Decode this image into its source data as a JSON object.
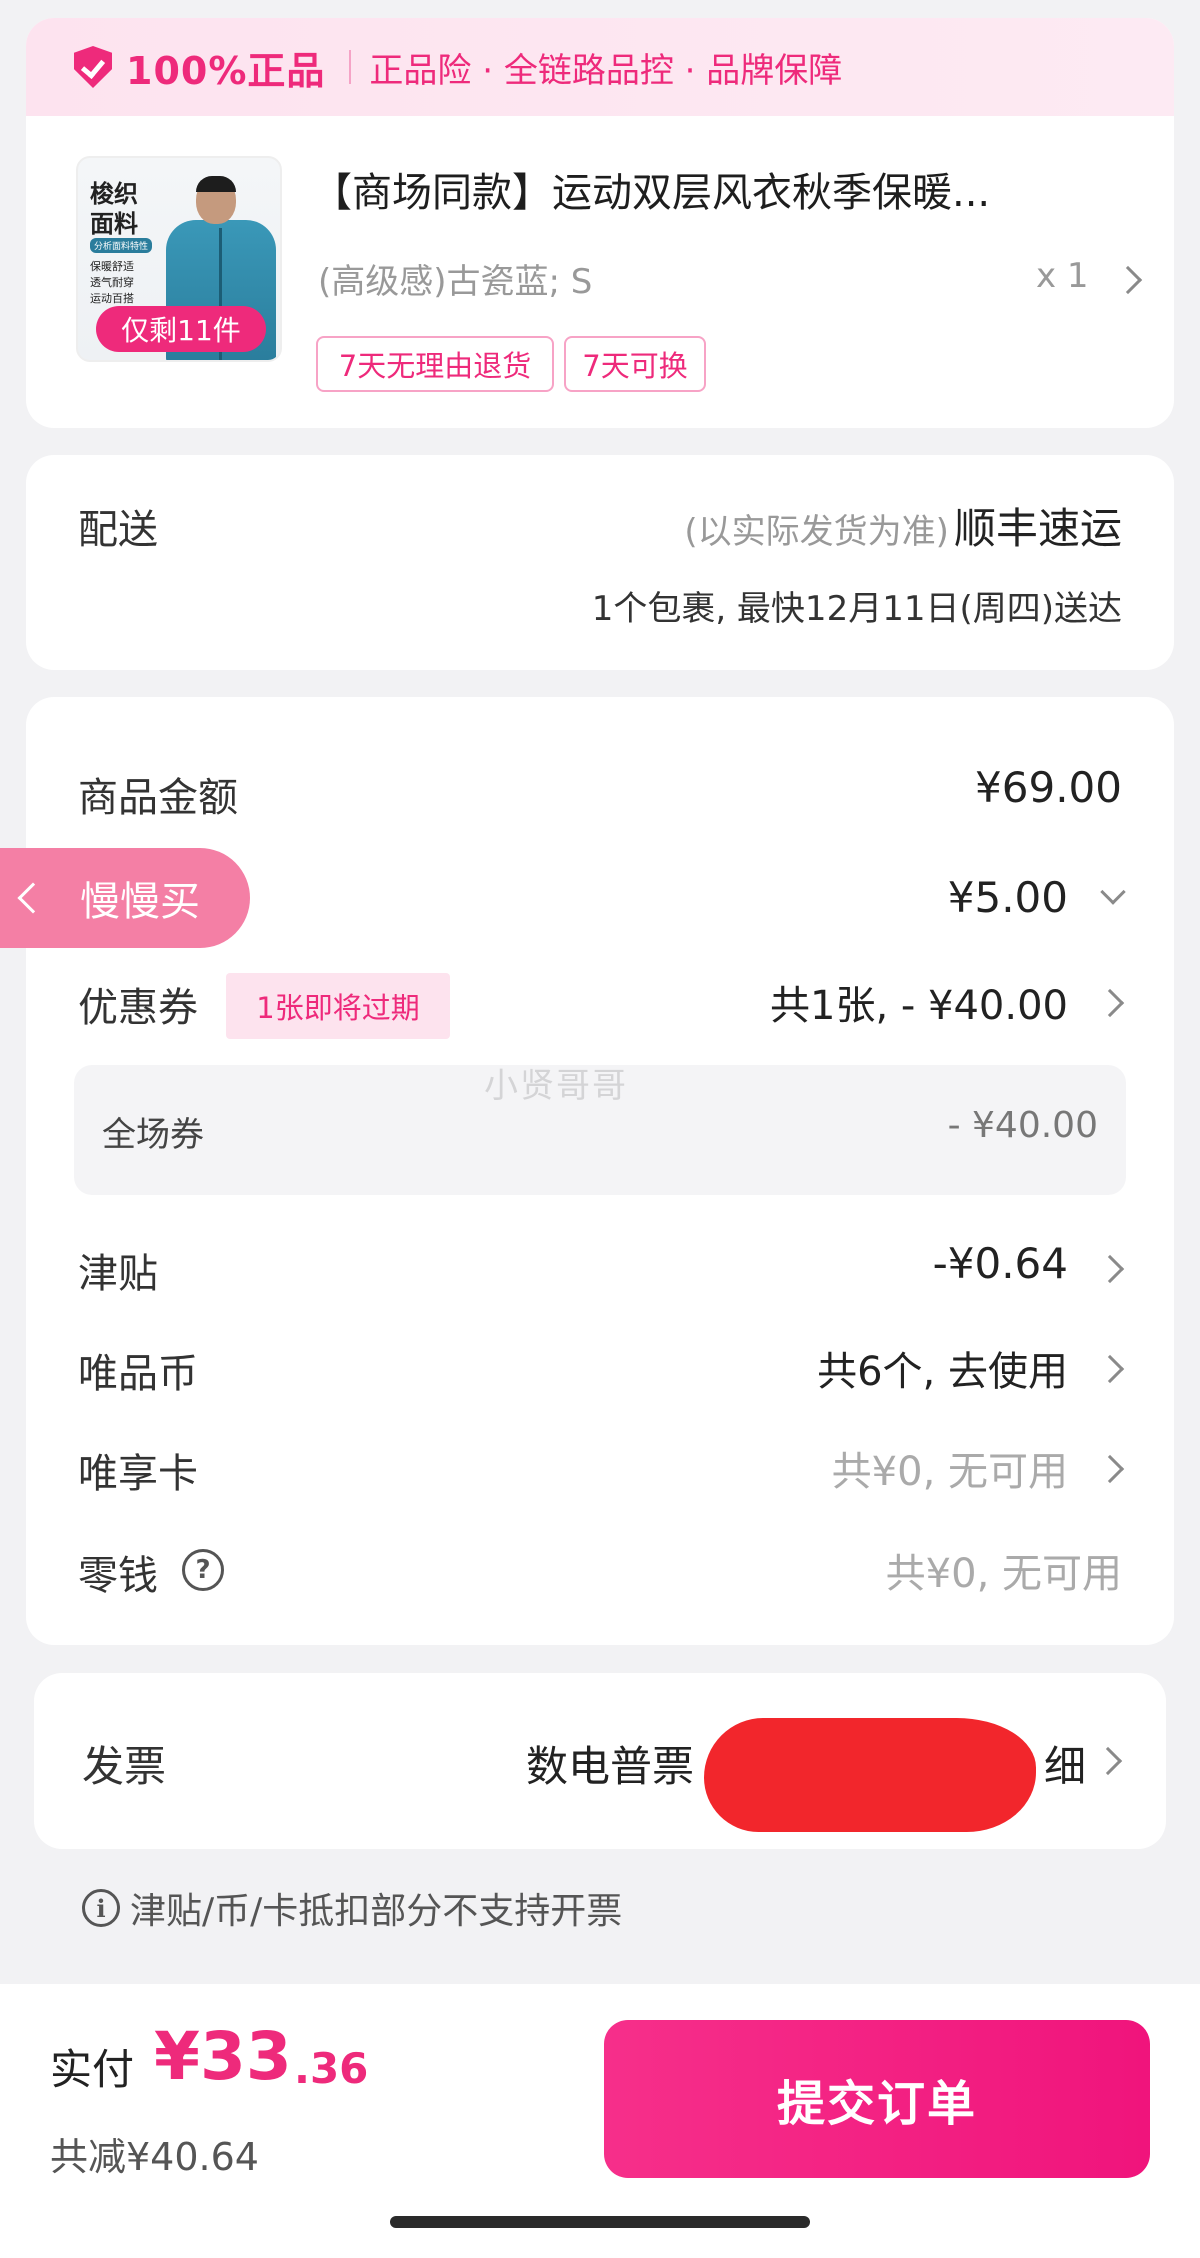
{
  "colors": {
    "accent": "#ee2a7b",
    "background": "#f2f2f4",
    "redaction": "#f2262c"
  },
  "guarantee": {
    "icon": "shield-check-icon",
    "title": "100%正品",
    "items": "正品险 · 全链路品控 · 品牌保障"
  },
  "product": {
    "thumb_text_1": "梭织",
    "thumb_text_2": "面料",
    "thumb_caption": "分析面料特性",
    "thumb_features": [
      "保暖舒适",
      "透气耐穿",
      "运动百搭"
    ],
    "stock_badge": "仅剩11件",
    "title": "【商场同款】运动双层风衣秋季保暖...",
    "spec": "(高级感)古瓷蓝; S",
    "quantity": "x 1",
    "tags": [
      "7天无理由退货",
      "7天可换"
    ]
  },
  "delivery": {
    "label": "配送",
    "note": "(以实际发货为准)",
    "carrier": "顺丰速运",
    "eta": "1个包裹, 最快12月11日(周四)送达"
  },
  "summary": {
    "goods_amount_label": "商品金额",
    "goods_amount": "¥69.00",
    "shipping_amount": "¥5.00",
    "coupon_label": "优惠券",
    "coupon_badge": "1张即将过期",
    "coupon_value": "共1张, - ¥40.00",
    "coupon_detail_label": "全场券",
    "coupon_detail_value": "- ¥40.00",
    "subsidy_label": "津贴",
    "subsidy_value": "-¥0.64",
    "coin_label": "唯品币",
    "coin_value": "共6个, 去使用",
    "card_label": "唯享卡",
    "card_value": "共¥0, 无可用",
    "change_label": "零钱",
    "change_value": "共¥0, 无可用"
  },
  "float_tab": {
    "label": "慢慢买"
  },
  "watermark": "小贤哥哥",
  "invoice": {
    "label": "发票",
    "value_prefix": "数电普票",
    "value_suffix": "细"
  },
  "invoice_note": "津贴/币/卡抵扣部分不支持开票",
  "footer": {
    "pay_label": "实付",
    "pay_currency": "¥",
    "pay_integer": "33",
    "pay_decimal": ".36",
    "saved": "共减¥40.64",
    "submit_label": "提交订单"
  }
}
